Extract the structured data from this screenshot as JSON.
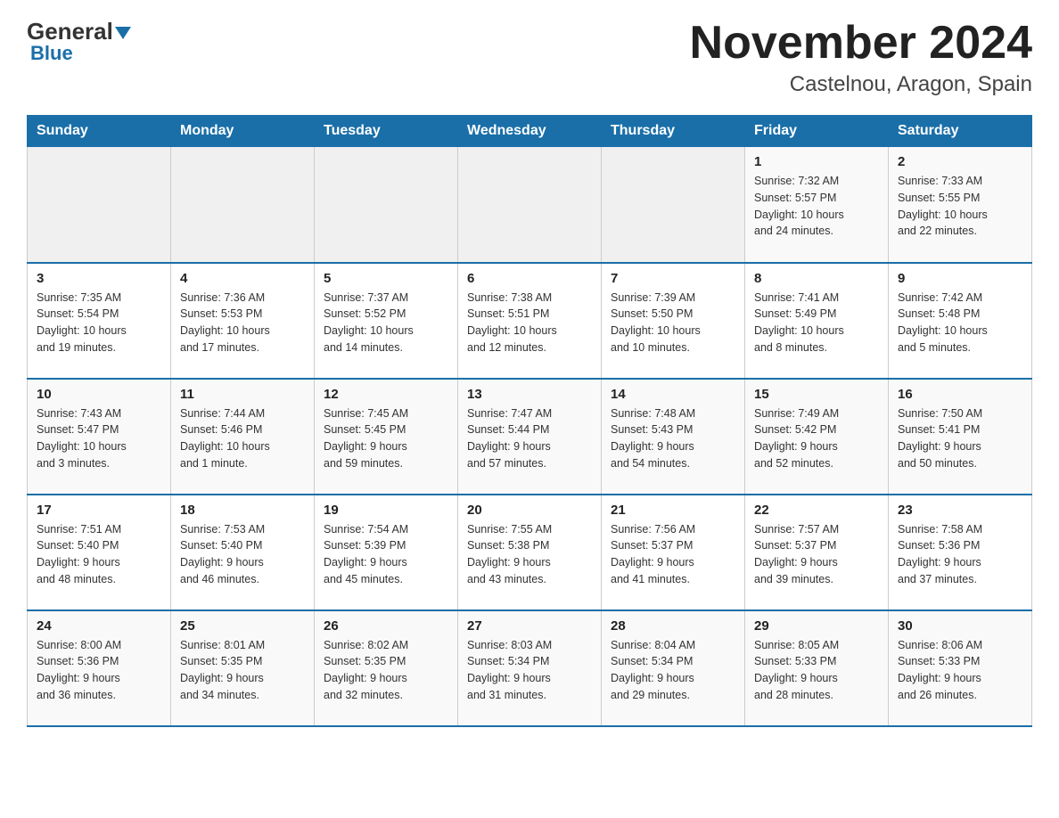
{
  "header": {
    "logo_general": "General",
    "logo_blue": "Blue",
    "month_title": "November 2024",
    "location": "Castelnou, Aragon, Spain"
  },
  "weekdays": [
    "Sunday",
    "Monday",
    "Tuesday",
    "Wednesday",
    "Thursday",
    "Friday",
    "Saturday"
  ],
  "weeks": [
    [
      {
        "day": "",
        "info": ""
      },
      {
        "day": "",
        "info": ""
      },
      {
        "day": "",
        "info": ""
      },
      {
        "day": "",
        "info": ""
      },
      {
        "day": "",
        "info": ""
      },
      {
        "day": "1",
        "info": "Sunrise: 7:32 AM\nSunset: 5:57 PM\nDaylight: 10 hours\nand 24 minutes."
      },
      {
        "day": "2",
        "info": "Sunrise: 7:33 AM\nSunset: 5:55 PM\nDaylight: 10 hours\nand 22 minutes."
      }
    ],
    [
      {
        "day": "3",
        "info": "Sunrise: 7:35 AM\nSunset: 5:54 PM\nDaylight: 10 hours\nand 19 minutes."
      },
      {
        "day": "4",
        "info": "Sunrise: 7:36 AM\nSunset: 5:53 PM\nDaylight: 10 hours\nand 17 minutes."
      },
      {
        "day": "5",
        "info": "Sunrise: 7:37 AM\nSunset: 5:52 PM\nDaylight: 10 hours\nand 14 minutes."
      },
      {
        "day": "6",
        "info": "Sunrise: 7:38 AM\nSunset: 5:51 PM\nDaylight: 10 hours\nand 12 minutes."
      },
      {
        "day": "7",
        "info": "Sunrise: 7:39 AM\nSunset: 5:50 PM\nDaylight: 10 hours\nand 10 minutes."
      },
      {
        "day": "8",
        "info": "Sunrise: 7:41 AM\nSunset: 5:49 PM\nDaylight: 10 hours\nand 8 minutes."
      },
      {
        "day": "9",
        "info": "Sunrise: 7:42 AM\nSunset: 5:48 PM\nDaylight: 10 hours\nand 5 minutes."
      }
    ],
    [
      {
        "day": "10",
        "info": "Sunrise: 7:43 AM\nSunset: 5:47 PM\nDaylight: 10 hours\nand 3 minutes."
      },
      {
        "day": "11",
        "info": "Sunrise: 7:44 AM\nSunset: 5:46 PM\nDaylight: 10 hours\nand 1 minute."
      },
      {
        "day": "12",
        "info": "Sunrise: 7:45 AM\nSunset: 5:45 PM\nDaylight: 9 hours\nand 59 minutes."
      },
      {
        "day": "13",
        "info": "Sunrise: 7:47 AM\nSunset: 5:44 PM\nDaylight: 9 hours\nand 57 minutes."
      },
      {
        "day": "14",
        "info": "Sunrise: 7:48 AM\nSunset: 5:43 PM\nDaylight: 9 hours\nand 54 minutes."
      },
      {
        "day": "15",
        "info": "Sunrise: 7:49 AM\nSunset: 5:42 PM\nDaylight: 9 hours\nand 52 minutes."
      },
      {
        "day": "16",
        "info": "Sunrise: 7:50 AM\nSunset: 5:41 PM\nDaylight: 9 hours\nand 50 minutes."
      }
    ],
    [
      {
        "day": "17",
        "info": "Sunrise: 7:51 AM\nSunset: 5:40 PM\nDaylight: 9 hours\nand 48 minutes."
      },
      {
        "day": "18",
        "info": "Sunrise: 7:53 AM\nSunset: 5:40 PM\nDaylight: 9 hours\nand 46 minutes."
      },
      {
        "day": "19",
        "info": "Sunrise: 7:54 AM\nSunset: 5:39 PM\nDaylight: 9 hours\nand 45 minutes."
      },
      {
        "day": "20",
        "info": "Sunrise: 7:55 AM\nSunset: 5:38 PM\nDaylight: 9 hours\nand 43 minutes."
      },
      {
        "day": "21",
        "info": "Sunrise: 7:56 AM\nSunset: 5:37 PM\nDaylight: 9 hours\nand 41 minutes."
      },
      {
        "day": "22",
        "info": "Sunrise: 7:57 AM\nSunset: 5:37 PM\nDaylight: 9 hours\nand 39 minutes."
      },
      {
        "day": "23",
        "info": "Sunrise: 7:58 AM\nSunset: 5:36 PM\nDaylight: 9 hours\nand 37 minutes."
      }
    ],
    [
      {
        "day": "24",
        "info": "Sunrise: 8:00 AM\nSunset: 5:36 PM\nDaylight: 9 hours\nand 36 minutes."
      },
      {
        "day": "25",
        "info": "Sunrise: 8:01 AM\nSunset: 5:35 PM\nDaylight: 9 hours\nand 34 minutes."
      },
      {
        "day": "26",
        "info": "Sunrise: 8:02 AM\nSunset: 5:35 PM\nDaylight: 9 hours\nand 32 minutes."
      },
      {
        "day": "27",
        "info": "Sunrise: 8:03 AM\nSunset: 5:34 PM\nDaylight: 9 hours\nand 31 minutes."
      },
      {
        "day": "28",
        "info": "Sunrise: 8:04 AM\nSunset: 5:34 PM\nDaylight: 9 hours\nand 29 minutes."
      },
      {
        "day": "29",
        "info": "Sunrise: 8:05 AM\nSunset: 5:33 PM\nDaylight: 9 hours\nand 28 minutes."
      },
      {
        "day": "30",
        "info": "Sunrise: 8:06 AM\nSunset: 5:33 PM\nDaylight: 9 hours\nand 26 minutes."
      }
    ]
  ]
}
